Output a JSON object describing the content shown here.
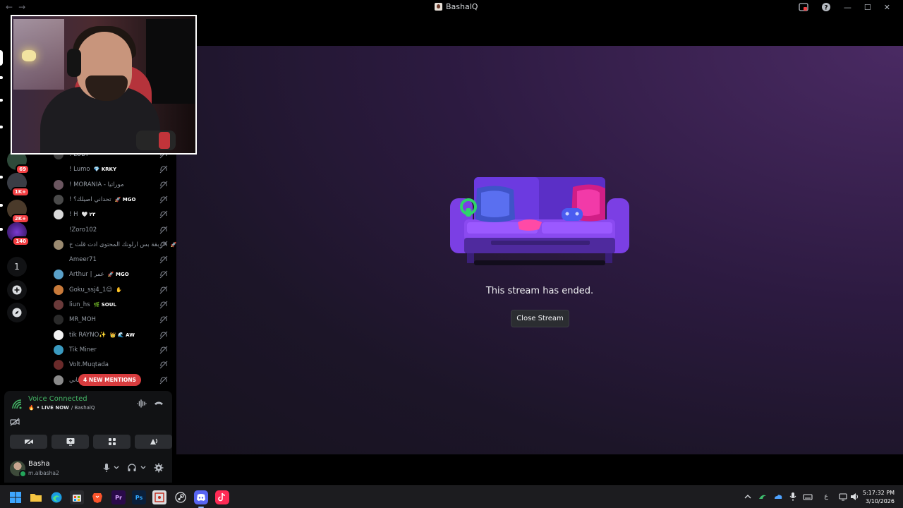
{
  "titlebar": {
    "title": "BashalQ",
    "back": "←",
    "forward": "→",
    "minimize": "—",
    "maximize": "☐",
    "close": "✕"
  },
  "rail": {
    "badges": [
      "69",
      "1K+",
      "2K+",
      "140"
    ],
    "server_count": "1"
  },
  "voice_users": [
    {
      "name": "! LOBY",
      "tag": "",
      "avatar": "#3b3b3b"
    },
    {
      "name": "! Lumo",
      "tag": "💎 KRKY",
      "avatar": ""
    },
    {
      "name": "! MORANIA - موراتيا",
      "tag": "",
      "avatar": "#6b5660"
    },
    {
      "name": "! تحداني اصيلك؟",
      "tag": "🚀 MGO",
      "avatar": "#4a4a4a"
    },
    {
      "name": "! H",
      "tag": "🤍 ۲۳",
      "avatar": "#d9d9d9"
    },
    {
      "name": "!Zoro102",
      "tag": "",
      "avatar": ""
    },
    {
      "name": "بقة بس ارلونك المحتوى ادت قلت خ_>",
      "tag": "🚀",
      "avatar": "#9a8a70"
    },
    {
      "name": "Ameer71",
      "tag": "",
      "avatar": ""
    },
    {
      "name": "Arthur | عمر",
      "tag": "🚀 MGO",
      "avatar": "#5aa0c8"
    },
    {
      "name": "Goku_ssj4_1😊",
      "tag": "✋",
      "avatar": "#c87a3a"
    },
    {
      "name": "liun_hs",
      "tag": "🌿 SOUL",
      "avatar": "#6a3a3a"
    },
    {
      "name": "MR_MOH",
      "tag": "",
      "avatar": "#2a2a2a"
    },
    {
      "name": "tik RAYNO✨",
      "tag": "👑 🌊 AW",
      "avatar": "#f2f2f2"
    },
    {
      "name": "Tik Miner",
      "tag": "",
      "avatar": "#3a9ac0"
    },
    {
      "name": "Volt.Muqtada",
      "tag": "",
      "avatar": "#6a2a2a"
    },
    {
      "name": "ناني",
      "tag": "KRKY",
      "avatar": "#8a8a8a"
    }
  ],
  "mentions_pill": "4 NEW MENTIONS",
  "voice_panel": {
    "status": "Voice Connected",
    "live_label": "• LIVE NOW",
    "channel": "/ BashalQ"
  },
  "user": {
    "name": "Basha",
    "status": "m.albasha2"
  },
  "stream": {
    "message": "This stream has ended.",
    "close_button": "Close Stream"
  },
  "taskbar": {
    "apps": [
      "windows-start",
      "file-explorer",
      "edge",
      "store",
      "brave",
      "premiere",
      "photoshop",
      "snip",
      "steam",
      "discord",
      "tiktok"
    ],
    "premiere_label": "Pr",
    "photoshop_label": "Ps",
    "input_lang": "ع",
    "time": "5:17:32 PM",
    "date": "3/10/2026"
  },
  "colors": {
    "accent_green": "#44b566",
    "mention_red": "#d83c3e",
    "discord_blurple": "#5865f2"
  }
}
